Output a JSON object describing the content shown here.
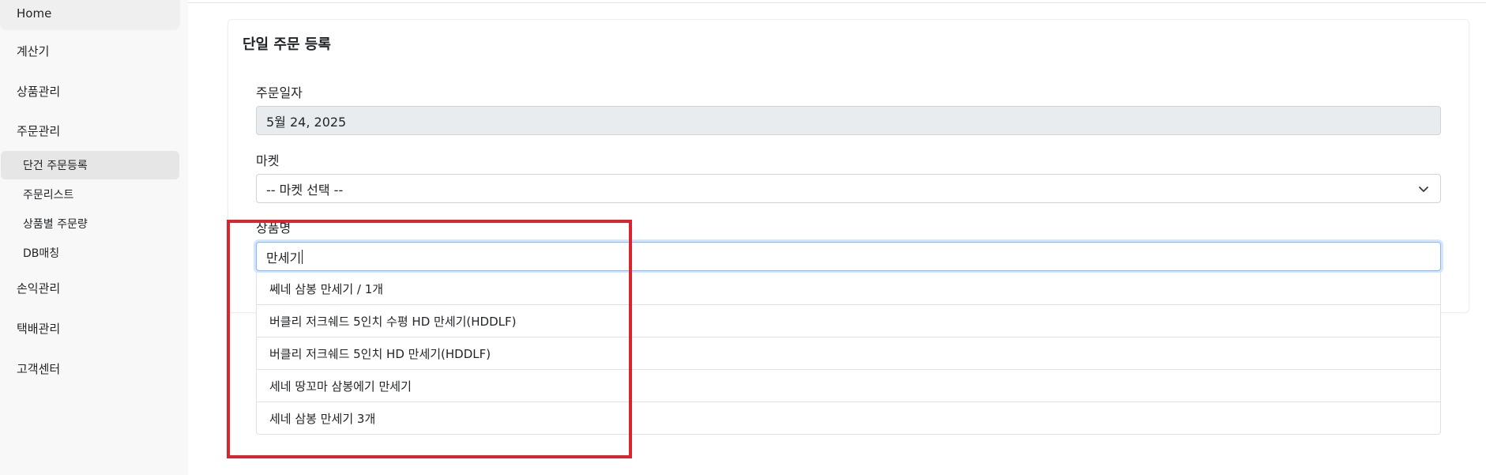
{
  "sidebar": {
    "items": [
      {
        "label": "Home"
      },
      {
        "label": "계산기"
      },
      {
        "label": "상품관리"
      },
      {
        "label": "주문관리"
      },
      {
        "label": "손익관리"
      },
      {
        "label": "택배관리"
      },
      {
        "label": "고객센터"
      }
    ],
    "subitems": [
      {
        "label": "단건 주문등록",
        "active": true
      },
      {
        "label": "주문리스트"
      },
      {
        "label": "상품별 주문량"
      },
      {
        "label": "DB매칭"
      }
    ]
  },
  "form": {
    "title": "단일 주문 등록",
    "order_date": {
      "label": "주문일자",
      "value": "5월 24, 2025"
    },
    "market": {
      "label": "마켓",
      "selected": "-- 마켓 선택 --"
    },
    "product": {
      "label": "상품명",
      "value": "만세기"
    }
  },
  "suggestions": [
    "쎄네 삼봉 만세기 / 1개",
    "버클리 저크쉐드 5인치 수평 HD 만세기(HDDLF)",
    "버클리 저크쉐드 5인치 HD 만세기(HDDLF)",
    "세네 땅꼬마 삼봉에기 만세기",
    "세네 삼봉 만세기 3개"
  ],
  "colors": {
    "highlight": "#d9262e",
    "focus_border": "#86b7fe",
    "disabled_bg": "#e9ecef"
  }
}
